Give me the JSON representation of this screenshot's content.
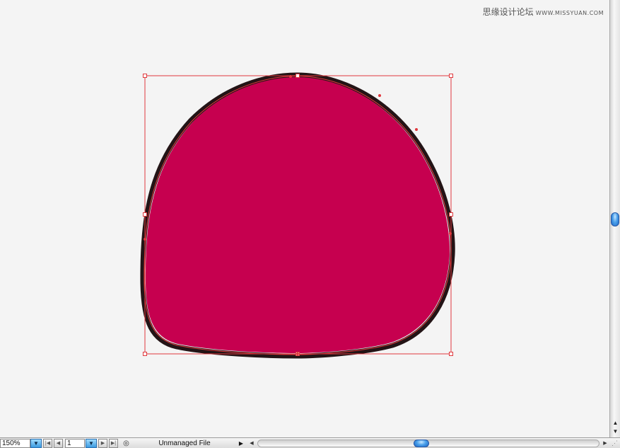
{
  "watermark": {
    "text": "思缘设计论坛",
    "site": "WWW.MISSYUAN.COM"
  },
  "artwork": {
    "fill_color": "#c6004f",
    "stroke_color": "#231416",
    "selection_color": "#e0393e"
  },
  "statusbar": {
    "zoom_value": "150%",
    "dropdown_glyph": "▼",
    "first_glyph": "|◀",
    "prev_glyph": "◀",
    "page_value": "1",
    "next_glyph": "▶",
    "last_glyph": "▶|",
    "toggle_glyph": "◎",
    "status_text": "Unmanaged File",
    "status_arrow_glyph": "▶",
    "scroll_left_glyph": "◀",
    "scroll_right_glyph": "▶",
    "grip_glyph": "⋰"
  },
  "vscroll": {
    "up_glyph": "▲",
    "down_glyph": "▼"
  }
}
